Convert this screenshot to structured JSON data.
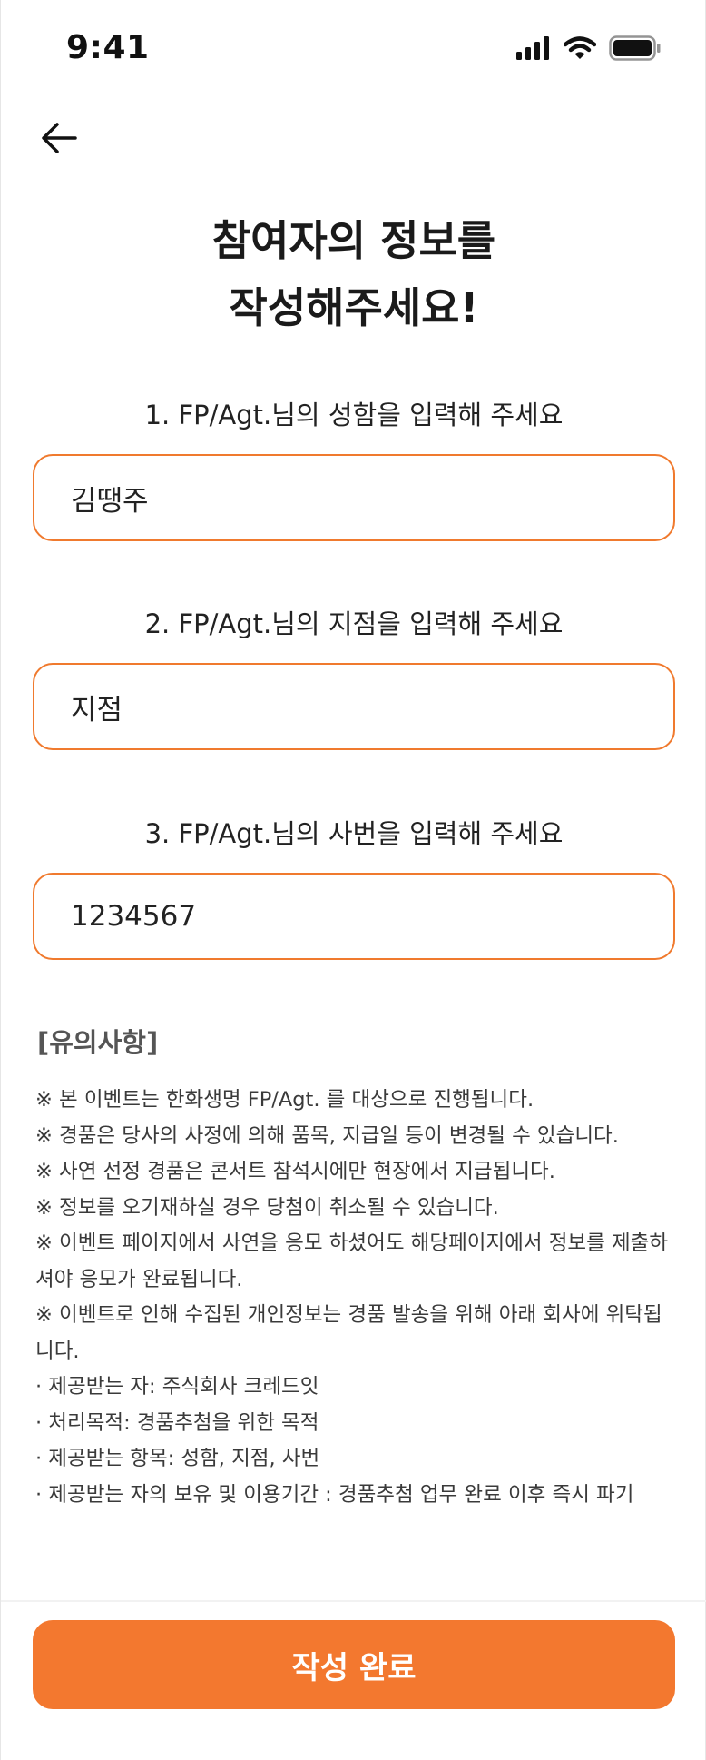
{
  "status_bar": {
    "time": "9:41",
    "icons": [
      "signal-icon",
      "wifi-icon",
      "battery-icon"
    ]
  },
  "header": {
    "back_icon": "arrow-left-icon",
    "title_line1": "참여자의 정보를",
    "title_line2": "작성해주세요!"
  },
  "form": {
    "name": {
      "label": "1. FP/Agt.님의 성함을 입력해 주세요",
      "value": "김땡주"
    },
    "branch": {
      "label": "2. FP/Agt.님의 지점을 입력해 주세요",
      "value": "지점"
    },
    "employee_id": {
      "label": "3. FP/Agt.님의 사번을 입력해 주세요",
      "value": "1234567"
    }
  },
  "notice": {
    "title": "[유의사항]",
    "items": [
      "※ 본 이벤트는 한화생명 FP/Agt. 를 대상으로 진행됩니다.",
      "※ 경품은 당사의 사정에 의해 품목, 지급일 등이 변경될 수 있습니다.",
      "※ 사연 선정 경품은 콘서트 참석시에만 현장에서 지급됩니다.",
      "※ 정보를 오기재하실 경우 당첨이 취소될 수 있습니다.",
      "※ 이벤트 페이지에서 사연을 응모 하셨어도 해당페이지에서 정보를 제출하셔야 응모가 완료됩니다.",
      "※ 이벤트로 인해 수집된 개인정보는 경품 발송을 위해 아래 회사에 위탁됩니다.",
      "· 제공받는 자: 주식회사 크레드잇",
      "· 처리목적: 경품추첨을 위한 목적",
      "· 제공받는 항목: 성함, 지점, 사번",
      "· 제공받는 자의 보유 및 이용기간 : 경품추첨 업무 완료 이후 즉시 파기"
    ]
  },
  "footer": {
    "submit_label": "작성 완료"
  },
  "colors": {
    "accent": "#f3782f",
    "input_border": "#f07a2e"
  }
}
